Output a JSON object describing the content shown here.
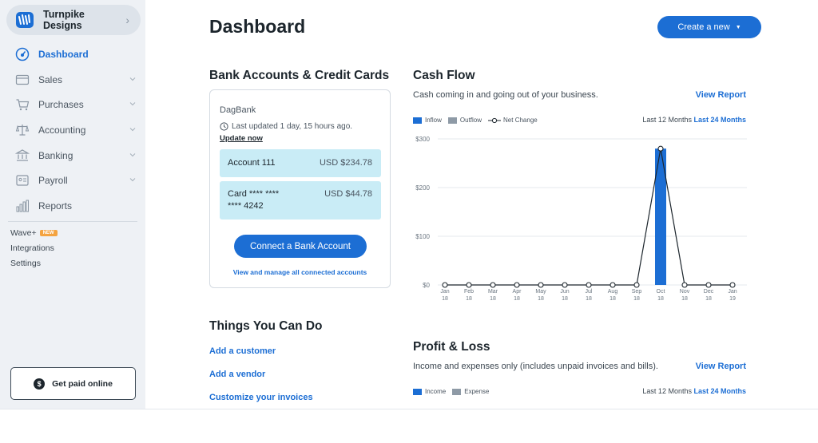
{
  "sidebar": {
    "business_name": "Turnpike Designs",
    "items": [
      {
        "label": "Dashboard",
        "icon": "dashboard-icon",
        "active": true
      },
      {
        "label": "Sales",
        "icon": "sales-icon"
      },
      {
        "label": "Purchases",
        "icon": "cart-icon"
      },
      {
        "label": "Accounting",
        "icon": "scales-icon"
      },
      {
        "label": "Banking",
        "icon": "bank-icon"
      },
      {
        "label": "Payroll",
        "icon": "payroll-icon"
      },
      {
        "label": "Reports",
        "icon": "bar-chart-icon"
      }
    ],
    "wave_plus": "Wave+",
    "new_badge": "NEW",
    "integrations": "Integrations",
    "settings": "Settings",
    "get_paid": "Get paid online",
    "get_paid_symbol": "$"
  },
  "header": {
    "title": "Dashboard",
    "create_label": "Create a new",
    "create_caret": "▼"
  },
  "bank": {
    "heading": "Bank Accounts & Credit Cards",
    "bank_name": "DagBank",
    "last_updated": "Last updated 1 day, 15 hours ago.",
    "update_now": "Update now",
    "accounts": [
      {
        "name": "Account 111",
        "amount": "USD $234.78"
      },
      {
        "name_line1": "Card **** ****",
        "name_line2": "**** 4242",
        "amount": "USD $44.78"
      }
    ],
    "connect_label": "Connect a Bank Account",
    "view_manage": "View and manage all connected accounts"
  },
  "things": {
    "heading": "Things You Can Do",
    "links": [
      "Add a customer",
      "Add a vendor",
      "Customize your invoices"
    ]
  },
  "cash_flow": {
    "heading": "Cash Flow",
    "description": "Cash coming in and going out of your business.",
    "view_report": "View Report",
    "legend": [
      "Inflow",
      "Outflow",
      "Net Change"
    ],
    "range_label": "Last 12 Months",
    "range_active": "Last 24 Months"
  },
  "profit_loss": {
    "heading": "Profit & Loss",
    "description": "Income and expenses only (includes unpaid invoices and bills).",
    "view_report": "View Report",
    "legend": [
      "Income",
      "Expense"
    ],
    "range_label": "Last 12 Months",
    "range_active": "Last 24 Months"
  },
  "colors": {
    "accent": "#1c6ed4",
    "inflow": "#1c6ed4",
    "outflow": "#8e9aa6",
    "account_bg": "#c9ecf6"
  },
  "chart_data": {
    "type": "bar",
    "categories": [
      "Jan 18",
      "Feb 18",
      "Mar 18",
      "Apr 18",
      "May 18",
      "Jun 18",
      "Jul 18",
      "Aug 18",
      "Sep 18",
      "Oct 18",
      "Nov 18",
      "Dec 18",
      "Jan 19"
    ],
    "tick_top": [
      "Jan",
      "Feb",
      "Mar",
      "Apr",
      "May",
      "Jun",
      "Jul",
      "Aug",
      "Sep",
      "Oct",
      "Nov",
      "Dec",
      "Jan"
    ],
    "tick_bottom": [
      "18",
      "18",
      "18",
      "18",
      "18",
      "18",
      "18",
      "18",
      "18",
      "18",
      "18",
      "18",
      "19"
    ],
    "series": [
      {
        "name": "Inflow",
        "values": [
          0,
          0,
          0,
          0,
          0,
          0,
          0,
          0,
          0,
          280,
          0,
          0,
          0
        ]
      },
      {
        "name": "Outflow",
        "values": [
          0,
          0,
          0,
          0,
          0,
          0,
          0,
          0,
          0,
          0,
          0,
          0,
          0
        ]
      },
      {
        "name": "Net Change",
        "values": [
          0,
          0,
          0,
          0,
          0,
          0,
          0,
          0,
          0,
          280,
          0,
          0,
          0
        ]
      }
    ],
    "y_ticks": [
      "$0",
      "$100",
      "$200",
      "$300"
    ],
    "ylim": [
      0,
      300
    ],
    "grid": true
  }
}
